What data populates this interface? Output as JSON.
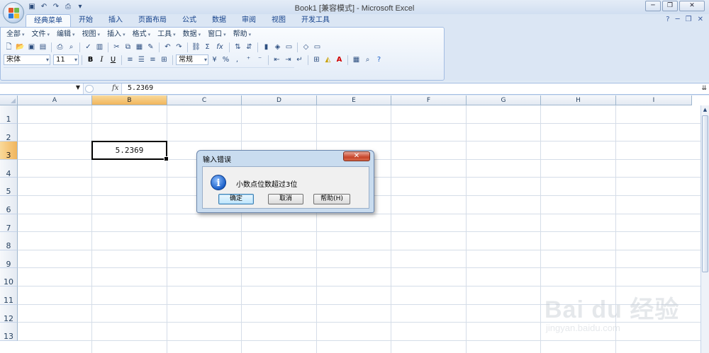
{
  "window": {
    "title": "Book1  [兼容模式] - Microsoft Excel"
  },
  "quick_access": {
    "icons": [
      "save-icon",
      "undo-icon",
      "redo-icon",
      "print-icon"
    ],
    "customize": "▾"
  },
  "window_controls": {
    "minimize": "─",
    "restore": "❐",
    "close": "✕"
  },
  "ribbon_tabs": [
    {
      "label": "经典菜单",
      "active": true
    },
    {
      "label": "开始",
      "active": false
    },
    {
      "label": "插入",
      "active": false
    },
    {
      "label": "页面布局",
      "active": false
    },
    {
      "label": "公式",
      "active": false
    },
    {
      "label": "数据",
      "active": false
    },
    {
      "label": "审阅",
      "active": false
    },
    {
      "label": "视图",
      "active": false
    },
    {
      "label": "开发工具",
      "active": false
    }
  ],
  "ribbon_right": {
    "help": "?",
    "minimize": "─",
    "restore": "❐",
    "close": "✕"
  },
  "classic_menu": [
    {
      "label": "全部"
    },
    {
      "label": "文件"
    },
    {
      "label": "编辑"
    },
    {
      "label": "视图"
    },
    {
      "label": "插入"
    },
    {
      "label": "格式"
    },
    {
      "label": "工具"
    },
    {
      "label": "数据"
    },
    {
      "label": "窗口"
    },
    {
      "label": "帮助"
    }
  ],
  "toolbar": {
    "font_name": "宋体",
    "font_size": "11",
    "bold": "B",
    "italic": "I",
    "underline": "U",
    "number_format": "常规",
    "percent": "%",
    "comma": ",",
    "sum": "Σ",
    "fx": "fx"
  },
  "formula_bar": {
    "name_box": "",
    "fx_label": "fx",
    "value": "5.2369"
  },
  "sheet": {
    "columns": [
      {
        "label": "A",
        "selected": false
      },
      {
        "label": "B",
        "selected": true
      },
      {
        "label": "C",
        "selected": false
      },
      {
        "label": "D",
        "selected": false
      },
      {
        "label": "E",
        "selected": false
      },
      {
        "label": "F",
        "selected": false
      },
      {
        "label": "G",
        "selected": false
      },
      {
        "label": "H",
        "selected": false
      },
      {
        "label": "I",
        "selected": false
      }
    ],
    "rows": [
      {
        "label": "1",
        "selected": false
      },
      {
        "label": "2",
        "selected": false
      },
      {
        "label": "3",
        "selected": true
      },
      {
        "label": "4",
        "selected": false
      },
      {
        "label": "5",
        "selected": false
      },
      {
        "label": "6",
        "selected": false
      },
      {
        "label": "7",
        "selected": false
      },
      {
        "label": "8",
        "selected": false
      },
      {
        "label": "9",
        "selected": false
      },
      {
        "label": "10",
        "selected": false
      },
      {
        "label": "11",
        "selected": false
      },
      {
        "label": "12",
        "selected": false
      },
      {
        "label": "13",
        "selected": false
      }
    ],
    "active_cell_value": "5.2369"
  },
  "dialog": {
    "title": "输入错误",
    "close": "✕",
    "icon": "info-icon",
    "message": "小数点位数超过3位",
    "buttons": {
      "ok": "确定",
      "cancel": "取消",
      "help": "帮助(H)"
    }
  },
  "watermark": {
    "brand": "Bai du 经验",
    "url": "jingyan.baidu.com"
  }
}
